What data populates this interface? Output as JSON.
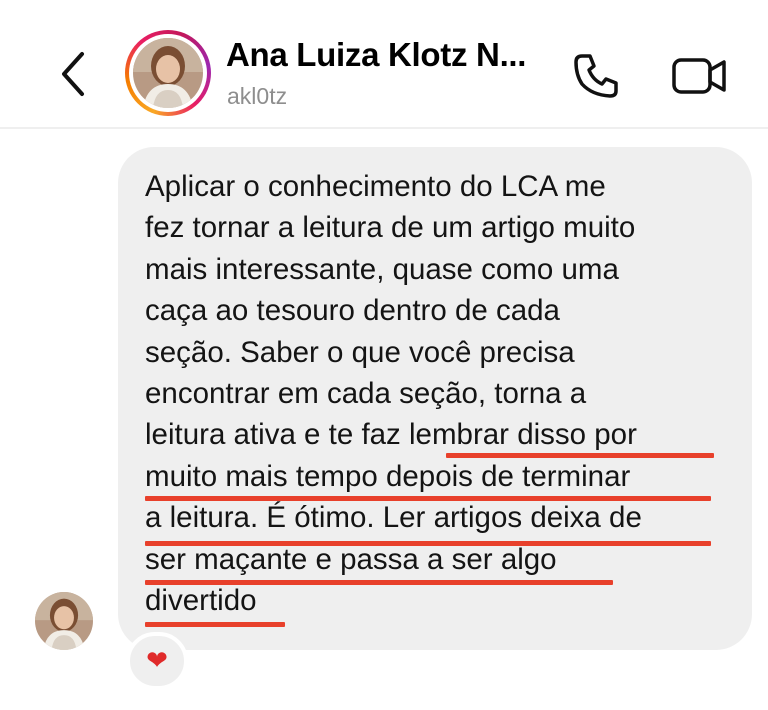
{
  "header": {
    "contact_name": "Ana Luiza Klotz N...",
    "handle": "akl0tz"
  },
  "icons": {
    "back": "chevron-left-icon",
    "call": "phone-icon",
    "video": "video-camera-icon",
    "reaction": "red-heart-emoji"
  },
  "message": {
    "lines": [
      "Aplicar o conhecimento do LCA me",
      "fez tornar a leitura de um artigo muito",
      "mais interessante, quase como uma",
      "caça ao tesouro dentro de cada",
      "seção. Saber o que você precisa",
      "encontrar em cada seção, torna a",
      "leitura ativa e te faz lembrar disso por",
      "muito mais tempo depois de terminar",
      "a leitura. É ótimo. Ler artigos deixa de",
      "ser maçante e passa a ser algo",
      "divertido"
    ],
    "highlight_color": "#e8402b"
  },
  "reaction": {
    "emoji": "❤"
  }
}
